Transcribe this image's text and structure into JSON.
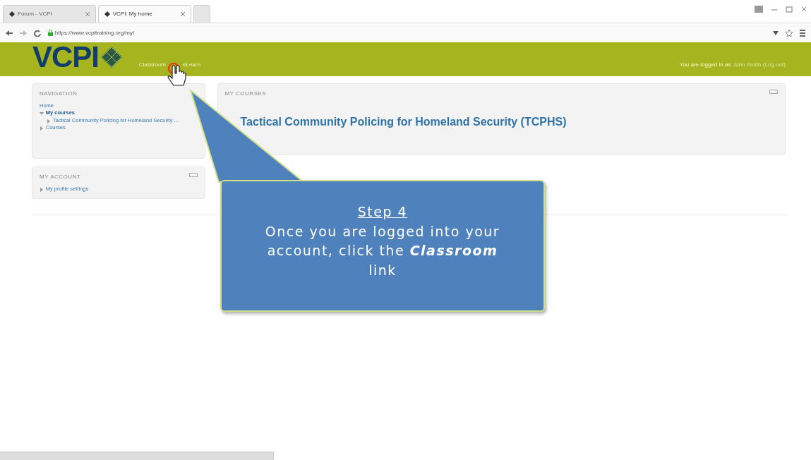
{
  "browser": {
    "tabs": [
      {
        "title": "Forum - VCPI",
        "selected": false
      },
      {
        "title": "VCPI: My home",
        "selected": true
      }
    ],
    "url": "https://www.vcpitraining.org/my/"
  },
  "header": {
    "logo": "VCPI",
    "links": [
      "Classroom",
      "eLearn"
    ],
    "login_text": "You are logged in as",
    "user": "John Smith",
    "logout": "(Log out)"
  },
  "navigation": {
    "title": "NAVIGATION",
    "items": [
      {
        "label": "Home",
        "kind": "link"
      },
      {
        "label": "My courses",
        "kind": "branch",
        "expanded": true,
        "children": [
          {
            "label": "Tactical Community Policing for Homeland Security ...",
            "kind": "branch",
            "expanded": false
          }
        ]
      },
      {
        "label": "Courses",
        "kind": "branch",
        "expanded": false
      }
    ]
  },
  "account": {
    "title": "MY ACCOUNT",
    "items": [
      {
        "label": "My profile settings",
        "kind": "branch",
        "expanded": false
      }
    ]
  },
  "courses": {
    "title": "MY COURSES",
    "items": [
      "Tactical Community Policing for Homeland Security (TCPHS)"
    ]
  },
  "callout": {
    "title": "Step 4",
    "text": "Once you are logged into your account, click the **Classroom** link"
  }
}
